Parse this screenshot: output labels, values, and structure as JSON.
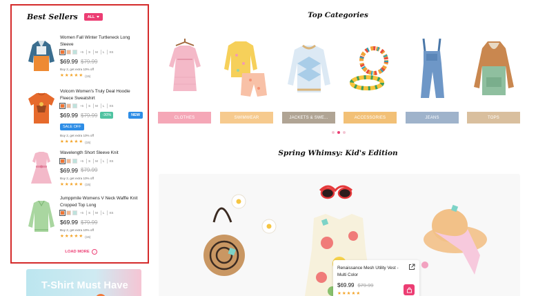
{
  "best_sellers": {
    "title": "Best Sellers",
    "filter": "ALL",
    "load_more": "LOAD MORE",
    "products": [
      {
        "name": "Women Fall Winter Turtleneck Long Sleeve",
        "swatches": [
          "#ee7433",
          "#f3b892",
          "#bfe3dd"
        ],
        "more_colors": "+5",
        "sizes": [
          "S",
          "M",
          "L",
          "XS"
        ],
        "price": "$69.99",
        "old_price": "$79.99",
        "promo": "Buy 2, get extra 10% off",
        "rating": 5,
        "reviews": "(15)"
      },
      {
        "name": "Volcom Women's Truly Deal Hoodie Fleece Sweatshirt",
        "swatches": [
          "#ee7433",
          "#f3b892",
          "#bfe3dd"
        ],
        "more_colors": "+5",
        "sizes": [
          "S",
          "M",
          "L",
          "XS"
        ],
        "price": "$69.99",
        "old_price": "$79.99",
        "discount": "-30%",
        "new_badge": "NEW",
        "sale_badge": "SALE OFF",
        "promo": "Buy 2, get extra 10% off",
        "rating": 5,
        "reviews": "(15)"
      },
      {
        "name": "Wavelength Short Sleeve Knit",
        "swatches": [
          "#ee7433",
          "#f3b892",
          "#bfe3dd"
        ],
        "more_colors": "+5",
        "sizes": [
          "S",
          "M",
          "L",
          "XS"
        ],
        "price": "$69.99",
        "old_price": "$79.99",
        "promo": "Buy 2, get extra 10% off",
        "rating": 5,
        "reviews": "(15)"
      },
      {
        "name": "Jumppmile Womens V Neck Waffle Knit Cropped Top Long",
        "swatches": [
          "#ee7433",
          "#f3b892",
          "#bfe3dd"
        ],
        "more_colors": "+5",
        "sizes": [
          "S",
          "M",
          "L",
          "XS"
        ],
        "price": "$69.99",
        "old_price": "$79.99",
        "promo": "Buy 2, get extra 10% off",
        "rating": 5,
        "reviews": "(15)"
      }
    ]
  },
  "banner": {
    "text": "T-Shirt Must Have"
  },
  "top_categories": {
    "title": "Top Categories",
    "items": [
      {
        "label": "CLOTHES",
        "color": "#f5a7b7"
      },
      {
        "label": "SWIMWEAR",
        "color": "#f6ca8e"
      },
      {
        "label": "JACKETS & SWE...",
        "color": "#b0a494"
      },
      {
        "label": "ACCESSORIES",
        "color": "#f2c076"
      },
      {
        "label": "JEANS",
        "color": "#9fb3cb"
      },
      {
        "label": "TOPS",
        "color": "#d9bf9e"
      }
    ]
  },
  "spring": {
    "title": "Spring Whimsy: Kid's Edition",
    "quick_view": {
      "name": "Renaissance Mesh Utility Vest - Multi Color",
      "price": "$69.99",
      "old_price": "$79.99",
      "rating": 5
    }
  },
  "colors": {
    "accent": "#ec3d73",
    "border": "#d42a2a",
    "star": "#f3a224",
    "badge_blue": "#2d8de6",
    "badge_green": "#4fc3a1"
  }
}
